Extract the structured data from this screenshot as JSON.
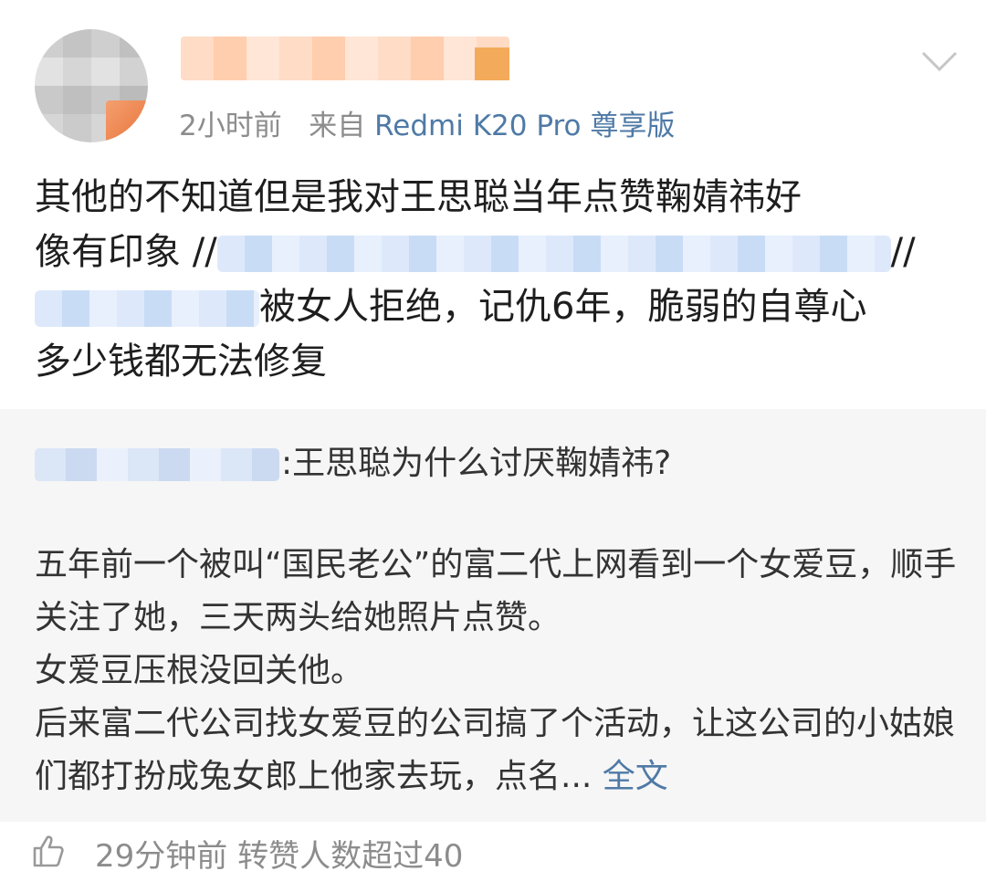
{
  "post": {
    "time": "2小时前",
    "source_prefix": "来自",
    "source_device": "Redmi K20 Pro 尊享版",
    "text_line1": "其他的不知道但是我对王思聪当年点赞鞠婧祎好",
    "text_line2_prefix": "像有印象 //",
    "text_line2_suffix": "//",
    "text_line3_suffix": "被女人拒绝，记仇6年，脆弱的自尊心",
    "text_line4": "多少钱都无法修复"
  },
  "quote": {
    "title": ":王思聪为什么讨厌鞠婧祎?",
    "paragraphs": [
      "五年前一个被叫“国民老公”的富二代上网看到一个女爱豆，顺手关注了她，三天两头给她照片点赞。",
      "女爱豆压根没回关他。",
      "后来富二代公司找女爱豆的公司搞了个活动，让这公司的小姑娘们都打扮成兔女郎上他家去玩，点名..."
    ],
    "more_label": "全文"
  },
  "footer": {
    "time": "29分钟前",
    "stats": "转赞人数超过40"
  },
  "icons": {
    "chevron": "chevron-down-icon",
    "like": "thumbs-up-icon"
  },
  "colors": {
    "link": "#4f7aa6",
    "meta": "#8c8c8c",
    "quote_bg": "#f6f6f6"
  }
}
